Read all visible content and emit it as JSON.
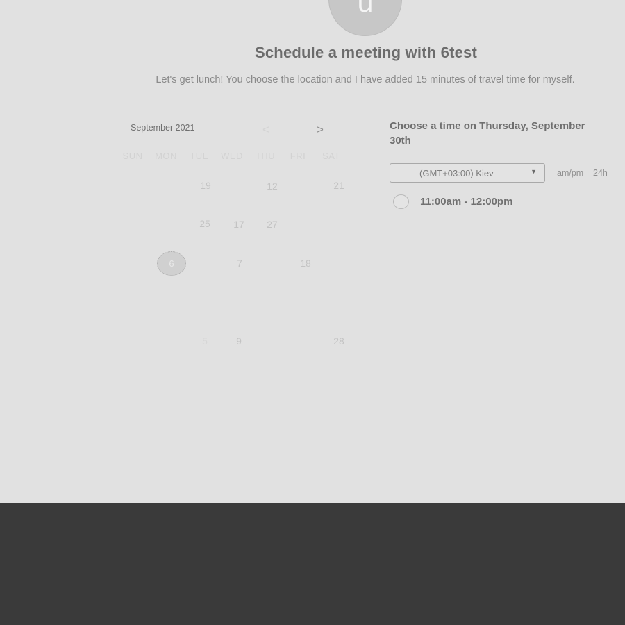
{
  "host": {
    "avatar_letter": "u",
    "title": "Schedule a meeting with 6test",
    "description": "Let's get lunch! You choose the location and I have added 15 minutes of travel time for myself."
  },
  "calendar": {
    "month_label": "September 2021",
    "prev": "<",
    "next": ">",
    "weekdays": [
      "SUN",
      "MON",
      "TUE",
      "WED",
      "THU",
      "FRI",
      "SAT"
    ],
    "visible_days": {
      "row1": [
        "19",
        "12",
        "21"
      ],
      "row2": [
        "25",
        "17",
        "27"
      ],
      "row3": [
        "7",
        "18"
      ],
      "row5": [
        "5",
        "9",
        "28"
      ]
    },
    "selected_day": "6"
  },
  "slots": {
    "heading": "Choose a time on Thursday, September 30th",
    "timezone": "(GMT+03:00) Kiev",
    "format_ampm": "am/pm",
    "format_24h": "24h",
    "items": [
      {
        "label": "11:00am - 12:00pm"
      }
    ]
  },
  "colors": {
    "background": "#e1e1e1",
    "footer": "#3a3a3a",
    "title_text": "#6c6c6c"
  }
}
